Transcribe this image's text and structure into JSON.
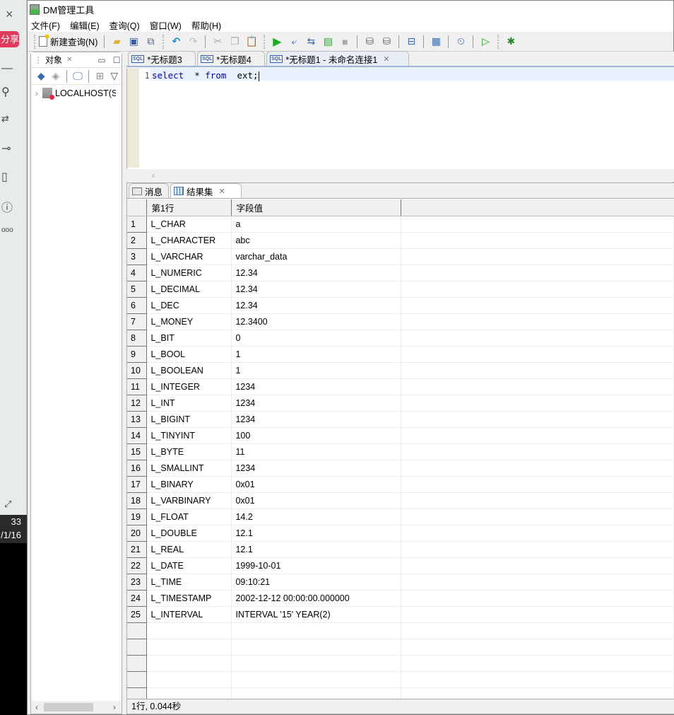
{
  "side_strip": {
    "close": "×",
    "share_label": "分享",
    "icons": [
      "minus-icon",
      "search-icon",
      "translate-icon",
      "settings-slider-icon",
      "book-search-icon",
      "help-icon",
      "more-icon",
      "fullscreen-icon"
    ],
    "clock_time": "33",
    "clock_date": "/1/16"
  },
  "app": {
    "title": "DM管理工具"
  },
  "menu": [
    {
      "label": "文件(F)"
    },
    {
      "label": "编辑(E)"
    },
    {
      "label": "查询(Q)"
    },
    {
      "label": "窗口(W)"
    },
    {
      "label": "帮助(H)"
    }
  ],
  "toolbar": {
    "new_query_label": "新建查询(N)"
  },
  "left_panel": {
    "tab_label": "对象",
    "tree": [
      {
        "label": "LOCALHOST(S'"
      }
    ]
  },
  "editor": {
    "tabs": [
      {
        "label": "*无标题3",
        "active": false
      },
      {
        "label": "*无标题4",
        "active": false
      },
      {
        "label": "*无标题1 - 未命名连接1",
        "active": true
      }
    ],
    "line_number": "1",
    "code": {
      "kw1": "select",
      "star": "*",
      "kw2": "from",
      "table": "ext;"
    }
  },
  "results": {
    "tabs": [
      {
        "label": "消息",
        "active": false
      },
      {
        "label": "结果集",
        "active": true
      }
    ],
    "columns": [
      "第1行",
      "字段值"
    ],
    "rows": [
      {
        "n": "1",
        "field": "L_CHAR",
        "value": "a"
      },
      {
        "n": "2",
        "field": "L_CHARACTER",
        "value": "abc"
      },
      {
        "n": "3",
        "field": "L_VARCHAR",
        "value": "varchar_data"
      },
      {
        "n": "4",
        "field": "L_NUMERIC",
        "value": "12.34"
      },
      {
        "n": "5",
        "field": "L_DECIMAL",
        "value": "12.34"
      },
      {
        "n": "6",
        "field": "L_DEC",
        "value": "12.34"
      },
      {
        "n": "7",
        "field": "L_MONEY",
        "value": "12.3400"
      },
      {
        "n": "8",
        "field": "L_BIT",
        "value": "0"
      },
      {
        "n": "9",
        "field": "L_BOOL",
        "value": "1"
      },
      {
        "n": "10",
        "field": "L_BOOLEAN",
        "value": "1"
      },
      {
        "n": "11",
        "field": "L_INTEGER",
        "value": "1234"
      },
      {
        "n": "12",
        "field": "L_INT",
        "value": "1234"
      },
      {
        "n": "13",
        "field": "L_BIGINT",
        "value": "1234"
      },
      {
        "n": "14",
        "field": "L_TINYINT",
        "value": "100"
      },
      {
        "n": "15",
        "field": "L_BYTE",
        "value": "11"
      },
      {
        "n": "16",
        "field": "L_SMALLINT",
        "value": "1234"
      },
      {
        "n": "17",
        "field": "L_BINARY",
        "value": "0x01"
      },
      {
        "n": "18",
        "field": "L_VARBINARY",
        "value": "0x01"
      },
      {
        "n": "19",
        "field": "L_FLOAT",
        "value": "14.2"
      },
      {
        "n": "20",
        "field": "L_DOUBLE",
        "value": "12.1"
      },
      {
        "n": "21",
        "field": "L_REAL",
        "value": "12.1"
      },
      {
        "n": "22",
        "field": "L_DATE",
        "value": "1999-10-01"
      },
      {
        "n": "23",
        "field": "L_TIME",
        "value": "09:10:21"
      },
      {
        "n": "24",
        "field": "L_TIMESTAMP",
        "value": "2002-12-12 00:00:00.000000"
      },
      {
        "n": "25",
        "field": "L_INTERVAL",
        "value": "INTERVAL '15' YEAR(2)"
      }
    ],
    "status": "1行, 0.044秒"
  }
}
